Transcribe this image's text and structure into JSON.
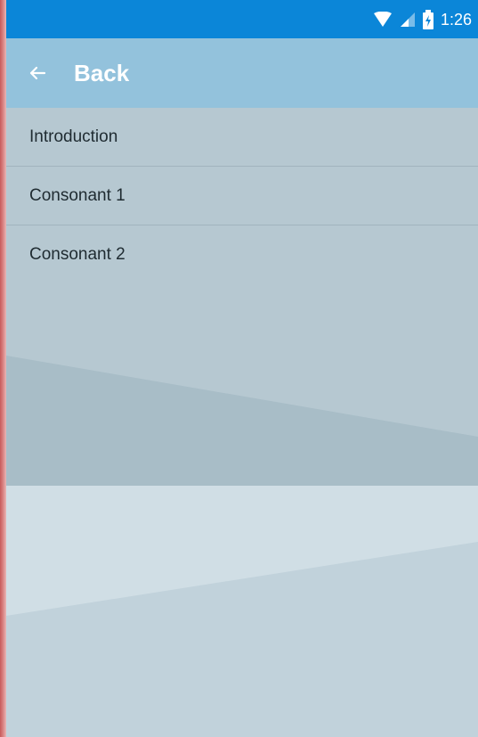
{
  "status_bar": {
    "time": "1:26",
    "icons": [
      "wifi-icon",
      "signal-icon",
      "battery-icon"
    ]
  },
  "appbar": {
    "back_label": "Back",
    "icon": "arrow-left-icon"
  },
  "menu": {
    "items": [
      {
        "label": "Introduction"
      },
      {
        "label": "Consonant 1"
      },
      {
        "label": "Consonant 2"
      }
    ]
  },
  "colors": {
    "status_bar": "#0b86d8",
    "appbar": "#93c2dc",
    "content_bg": "#b6c8d1",
    "left_edge": "#c85a5a"
  }
}
